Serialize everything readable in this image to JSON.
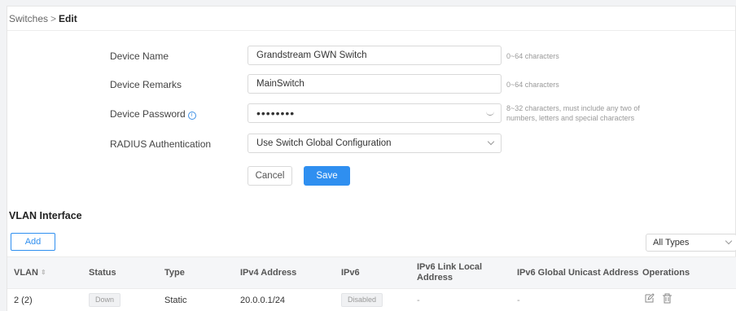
{
  "breadcrumb": {
    "parent": "Switches",
    "separator": ">",
    "current": "Edit"
  },
  "form": {
    "device_name": {
      "label": "Device Name",
      "value": "Grandstream GWN Switch",
      "hint": "0~64 characters"
    },
    "device_remarks": {
      "label": "Device Remarks",
      "value": "MainSwitch",
      "hint": "0~64 characters"
    },
    "device_password": {
      "label": "Device Password",
      "info_icon": "info-icon",
      "value": "••••••••",
      "hint_line1": "8~32 characters, must include any two of",
      "hint_line2": "numbers, letters and special characters"
    },
    "radius": {
      "label": "RADIUS Authentication",
      "value": "Use Switch Global Configuration"
    },
    "cancel_label": "Cancel",
    "save_label": "Save"
  },
  "vlan": {
    "title": "VLAN Interface",
    "add_label": "Add",
    "type_filter": "All Types",
    "columns": {
      "vlan": "VLAN",
      "status": "Status",
      "type": "Type",
      "ipv4": "IPv4 Address",
      "ipv6": "IPv6",
      "ipv6_link_local_line1": "IPv6 Link Local",
      "ipv6_link_local_line2": "Address",
      "ipv6_global": "IPv6 Global Unicast Address",
      "operations": "Operations"
    },
    "rows": [
      {
        "vlan": "2 (2)",
        "status": "Down",
        "type": "Static",
        "ipv4": "20.0.0.1/24",
        "ipv6": "Disabled",
        "ipv6_link_local": "-",
        "ipv6_global": "-"
      }
    ]
  },
  "colors": {
    "accent": "#2f8ff0",
    "background": "#f2f3f5"
  }
}
